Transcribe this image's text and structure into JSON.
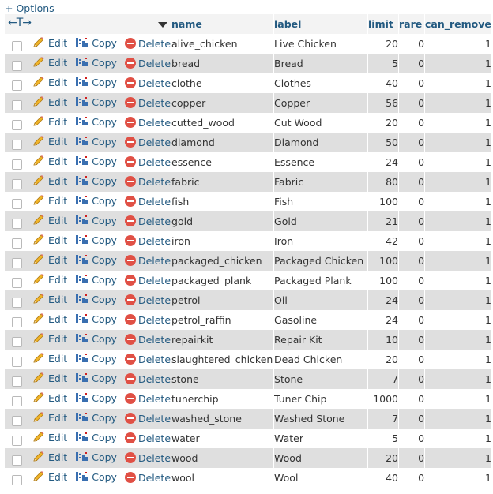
{
  "options_link": "+ Options",
  "header": {
    "arrows": "←T→",
    "name": "name",
    "label": "label",
    "limit": "limit",
    "rare": "rare",
    "can_remove": "can_remove"
  },
  "actions": {
    "edit": "Edit",
    "copy": "Copy",
    "delete": "Delete"
  },
  "colors": {
    "link": "#235a81",
    "row_alt": "#dfdfdf",
    "delete_icon": "#e05045"
  },
  "rows": [
    {
      "name": "alive_chicken",
      "label": "Live Chicken",
      "limit": "20",
      "rare": "0",
      "can_remove": "1"
    },
    {
      "name": "bread",
      "label": "Bread",
      "limit": "5",
      "rare": "0",
      "can_remove": "1"
    },
    {
      "name": "clothe",
      "label": "Clothes",
      "limit": "40",
      "rare": "0",
      "can_remove": "1"
    },
    {
      "name": "copper",
      "label": "Copper",
      "limit": "56",
      "rare": "0",
      "can_remove": "1"
    },
    {
      "name": "cutted_wood",
      "label": "Cut Wood",
      "limit": "20",
      "rare": "0",
      "can_remove": "1"
    },
    {
      "name": "diamond",
      "label": "Diamond",
      "limit": "50",
      "rare": "0",
      "can_remove": "1"
    },
    {
      "name": "essence",
      "label": "Essence",
      "limit": "24",
      "rare": "0",
      "can_remove": "1"
    },
    {
      "name": "fabric",
      "label": "Fabric",
      "limit": "80",
      "rare": "0",
      "can_remove": "1"
    },
    {
      "name": "fish",
      "label": "Fish",
      "limit": "100",
      "rare": "0",
      "can_remove": "1"
    },
    {
      "name": "gold",
      "label": "Gold",
      "limit": "21",
      "rare": "0",
      "can_remove": "1"
    },
    {
      "name": "iron",
      "label": "Iron",
      "limit": "42",
      "rare": "0",
      "can_remove": "1"
    },
    {
      "name": "packaged_chicken",
      "label": "Packaged Chicken",
      "limit": "100",
      "rare": "0",
      "can_remove": "1"
    },
    {
      "name": "packaged_plank",
      "label": "Packaged Plank",
      "limit": "100",
      "rare": "0",
      "can_remove": "1"
    },
    {
      "name": "petrol",
      "label": "Oil",
      "limit": "24",
      "rare": "0",
      "can_remove": "1"
    },
    {
      "name": "petrol_raffin",
      "label": "Gasoline",
      "limit": "24",
      "rare": "0",
      "can_remove": "1"
    },
    {
      "name": "repairkit",
      "label": "Repair Kit",
      "limit": "10",
      "rare": "0",
      "can_remove": "1"
    },
    {
      "name": "slaughtered_chicken",
      "label": "Dead Chicken",
      "limit": "20",
      "rare": "0",
      "can_remove": "1"
    },
    {
      "name": "stone",
      "label": "Stone",
      "limit": "7",
      "rare": "0",
      "can_remove": "1"
    },
    {
      "name": "tunerchip",
      "label": "Tuner Chip",
      "limit": "1000",
      "rare": "0",
      "can_remove": "1"
    },
    {
      "name": "washed_stone",
      "label": "Washed Stone",
      "limit": "7",
      "rare": "0",
      "can_remove": "1"
    },
    {
      "name": "water",
      "label": "Water",
      "limit": "5",
      "rare": "0",
      "can_remove": "1"
    },
    {
      "name": "wood",
      "label": "Wood",
      "limit": "20",
      "rare": "0",
      "can_remove": "1"
    },
    {
      "name": "wool",
      "label": "Wool",
      "limit": "40",
      "rare": "0",
      "can_remove": "1"
    }
  ]
}
